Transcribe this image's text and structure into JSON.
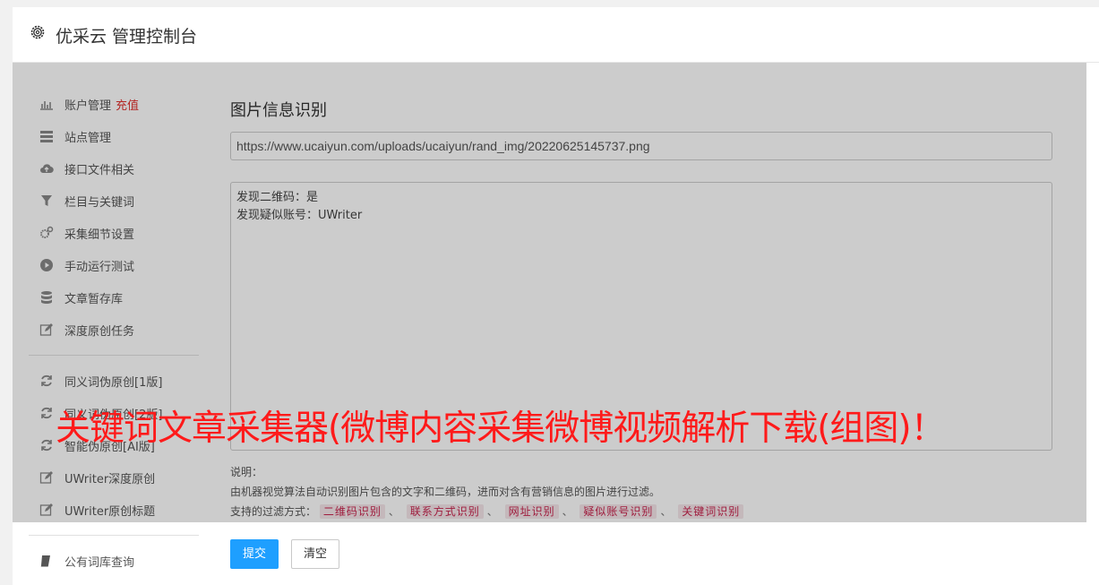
{
  "header": {
    "title": "优采云 管理控制台",
    "icon": "gear-icon"
  },
  "sidebar": {
    "items": [
      {
        "label": "账户管理",
        "extra": "充值",
        "icon": "bar-chart-icon"
      },
      {
        "label": "站点管理",
        "icon": "server-icon"
      },
      {
        "label": "接口文件相关",
        "icon": "cloud-upload-icon"
      },
      {
        "label": "栏目与关键词",
        "icon": "filter-icon"
      },
      {
        "label": "采集细节设置",
        "icon": "cogs-icon"
      },
      {
        "label": "手动运行测试",
        "icon": "play-circle-icon"
      },
      {
        "label": "文章暂存库",
        "icon": "database-icon"
      },
      {
        "label": "深度原创任务",
        "icon": "edit-icon"
      },
      {
        "label": "同义词伪原创[1版]",
        "icon": "refresh-icon"
      },
      {
        "label": "同义词伪原创[2版]",
        "icon": "refresh-icon"
      },
      {
        "label": "智能伪原创[AI版]",
        "icon": "refresh-icon"
      },
      {
        "label": "UWriter深度原创",
        "icon": "edit-icon"
      },
      {
        "label": "UWriter原创标题",
        "icon": "edit-icon"
      },
      {
        "label": "公有词库查询",
        "icon": "book-icon"
      }
    ]
  },
  "main": {
    "title": "图片信息识别",
    "url_value": "https://www.ucaiyun.com/uploads/ucaiyun/rand_img/20220625145737.png",
    "result_lines": [
      "发现二维码：是",
      "发现疑似账号：UWriter"
    ],
    "notes_title": "说明：",
    "notes_desc": "由机器视觉算法自动识别图片包含的文字和二维码，进而对含有营销信息的图片进行过滤。",
    "filters_label": "支持的过滤方式：",
    "filters": [
      "二维码识别",
      "联系方式识别",
      "网址识别",
      "疑似账号识别",
      "关键词识别"
    ],
    "filter_sep": "、"
  },
  "buttons": {
    "submit": "提交",
    "clear": "清空"
  },
  "banner": "关键词文章采集器(微博内容采集微博视频解析下载(组图)！",
  "colors": {
    "primary": "#1e9fff",
    "danger": "#e0312e",
    "banner": "#ff1a1a",
    "tag": "#c7254e"
  }
}
